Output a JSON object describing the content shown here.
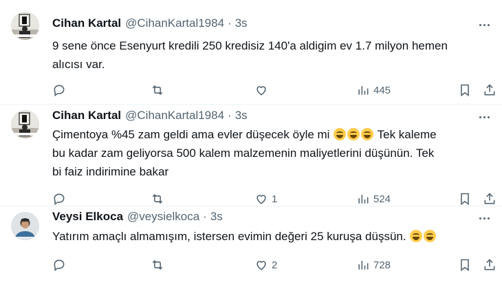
{
  "tweets": [
    {
      "name": "Cihan Kartal",
      "handle": "@CihanKartal1984",
      "separator": "·",
      "time": "3s",
      "line1": "9 sene önce Esenyurt kredili 250 kredisiz 140'a aldigim ev 1.7 milyon hemen",
      "line2": "alıcısı var.",
      "replies": "",
      "retweets": "",
      "likes": "",
      "views": "445"
    },
    {
      "name": "Cihan Kartal",
      "handle": "@CihanKartal1984",
      "separator": "·",
      "time": "3s",
      "line1a": "Çimentoya %45 zam geldi ama evler düşecek öyle mi",
      "line1b": "Tek kaleme",
      "line2": "bu kadar zam geliyorsa 500 kalem malzemenin maliyetlerini düşünün. Tek",
      "line3": "bi faiz indirimine bakar",
      "emojis": [
        "grinning-face-emoji",
        "grinning-face-emoji",
        "grinning-face-emoji"
      ],
      "replies": "",
      "retweets": "",
      "likes": "1",
      "views": "524"
    },
    {
      "name": "Veysi Elkoca",
      "handle": "@veysielkoca",
      "separator": "·",
      "time": "3s",
      "line1": "Yatırım amaçlı almamışım, istersen evimin değeri 25 kuruşa düşsün.",
      "emojis": [
        "tears-of-joy-emoji",
        "tears-of-joy-emoji"
      ],
      "replies": "",
      "retweets": "",
      "likes": "2",
      "views": "728"
    }
  ],
  "icons": {
    "reply": "reply-icon",
    "retweet": "retweet-icon",
    "like": "heart-icon",
    "views": "views-chart-icon",
    "bookmark": "bookmark-icon",
    "share": "share-icon",
    "more": "more-dots-icon"
  },
  "colors": {
    "text": "#0f1419",
    "secondary": "#536471",
    "divider": "#eff3f4",
    "emoji": "#ffcc4d"
  }
}
